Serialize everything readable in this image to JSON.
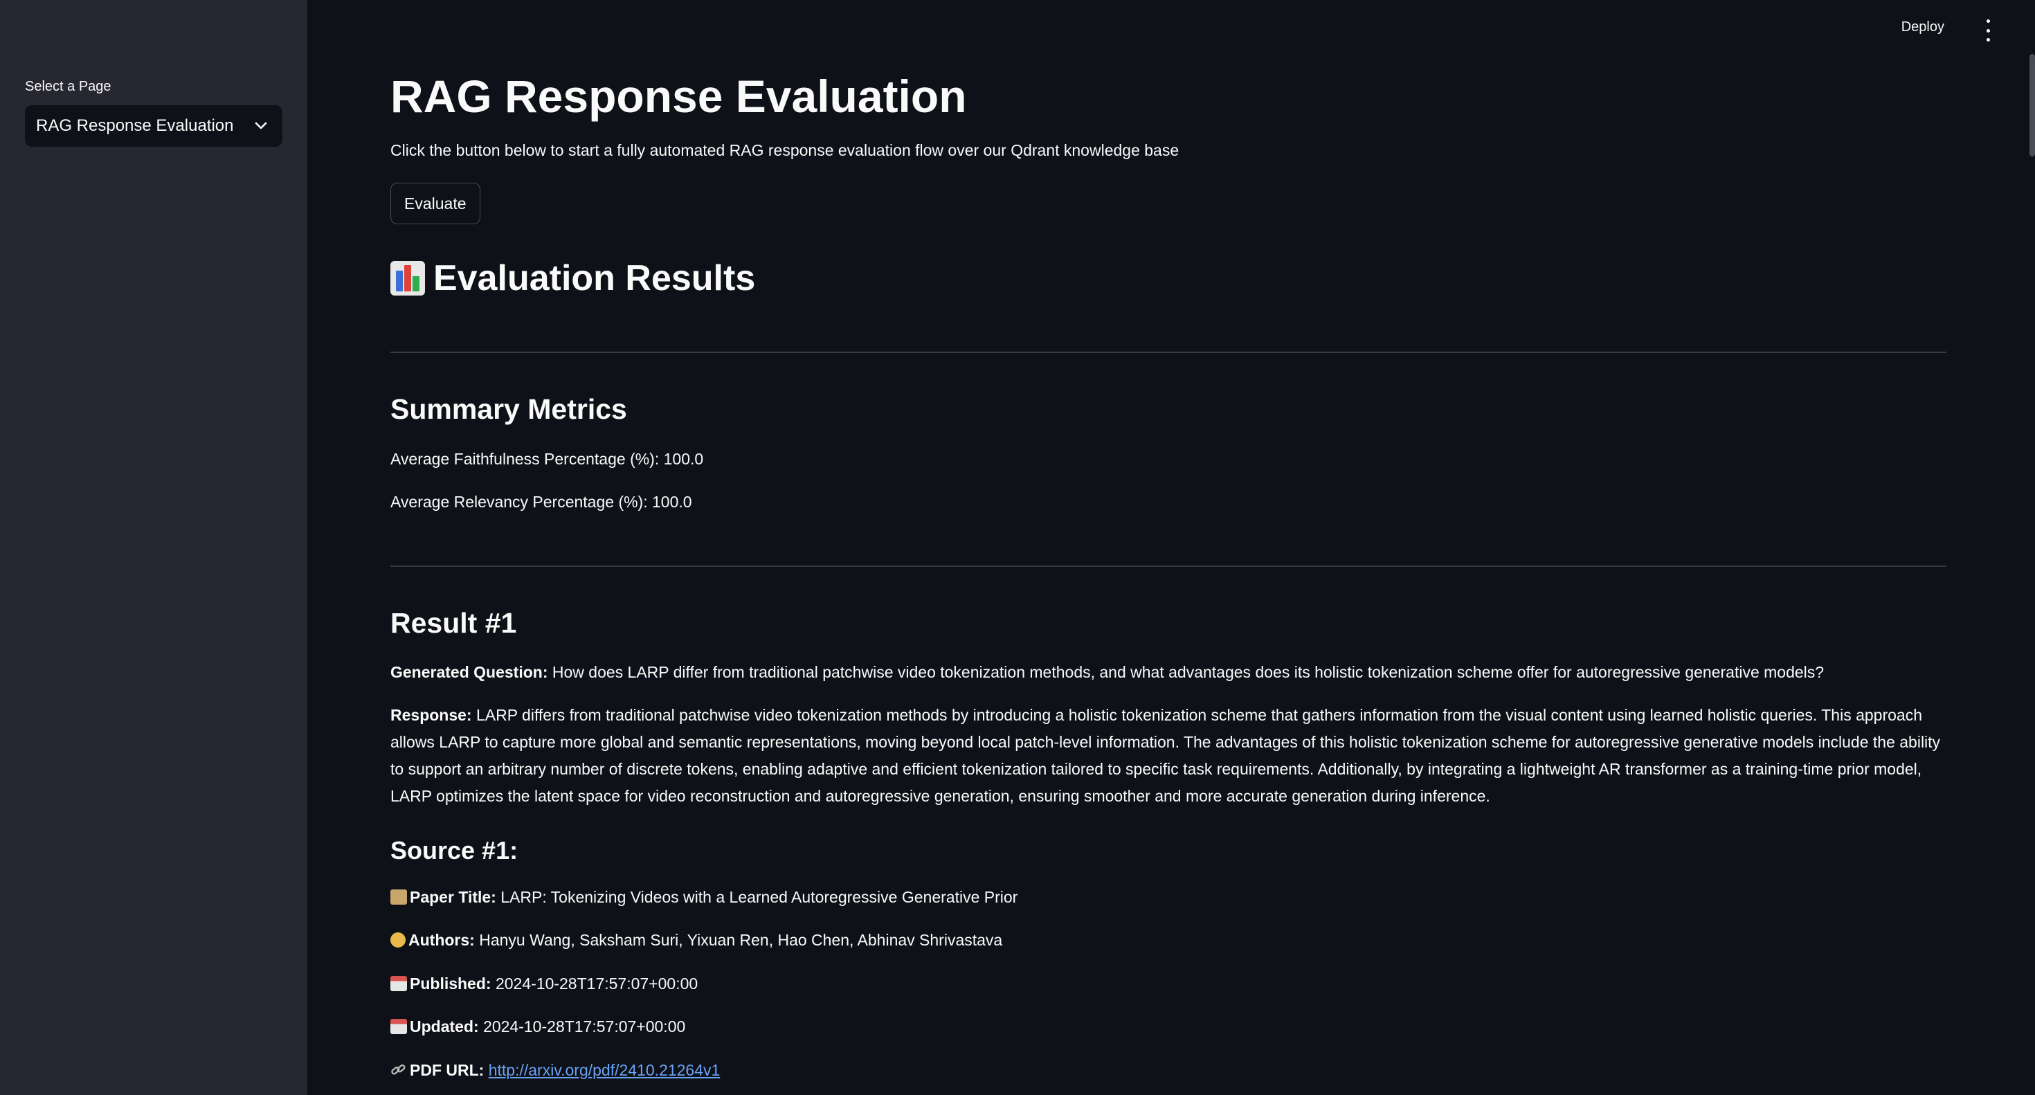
{
  "sidebar": {
    "select_label": "Select a Page",
    "selected_page": "RAG Response Evaluation"
  },
  "header": {
    "deploy_label": "Deploy"
  },
  "main": {
    "title": "RAG Response Evaluation",
    "intro": "Click the button below to start a fully automated RAG response evaluation flow over our Qdrant knowledge base",
    "evaluate_label": "Evaluate",
    "results_heading": "Evaluation Results",
    "summary": {
      "heading": "Summary Metrics",
      "faithfulness": "Average Faithfulness Percentage (%): 100.0",
      "relevancy": "Average Relevancy Percentage (%): 100.0"
    },
    "result": {
      "heading": "Result #1",
      "question_label": "Generated Question:",
      "question": "How does LARP differ from traditional patchwise video tokenization methods, and what advantages does its holistic tokenization scheme offer for autoregressive generative models?",
      "response_label": "Response:",
      "response": "LARP differs from traditional patchwise video tokenization methods by introducing a holistic tokenization scheme that gathers information from the visual content using learned holistic queries. This approach allows LARP to capture more global and semantic representations, moving beyond local patch-level information. The advantages of this holistic tokenization scheme for autoregressive generative models include the ability to support an arbitrary number of discrete tokens, enabling adaptive and efficient tokenization tailored to specific task requirements. Additionally, by integrating a lightweight AR transformer as a training-time prior model, LARP optimizes the latent space for video reconstruction and autoregressive generation, ensuring smoother and more accurate generation during inference."
    },
    "source": {
      "heading": "Source #1:",
      "paper_title_label": "Paper Title:",
      "paper_title": "LARP: Tokenizing Videos with a Learned Autoregressive Generative Prior",
      "authors_label": "Authors:",
      "authors": "Hanyu Wang, Saksham Suri, Yixuan Ren, Hao Chen, Abhinav Shrivastava",
      "published_label": "Published:",
      "published": "2024-10-28T17:57:07+00:00",
      "updated_label": "Updated:",
      "updated": "2024-10-28T17:57:07+00:00",
      "pdf_label": "PDF URL:",
      "pdf_url": "http://arxiv.org/pdf/2410.21264v1"
    }
  },
  "icons": {
    "results": "bar-chart-icon",
    "paper": "scroll-icon",
    "authors": "person-icon",
    "published": "calendar-icon",
    "updated": "calendar-icon",
    "pdf": "link-icon"
  },
  "colors": {
    "background": "#0e1117",
    "sidebar": "#262730",
    "link": "#6aa2f5"
  }
}
